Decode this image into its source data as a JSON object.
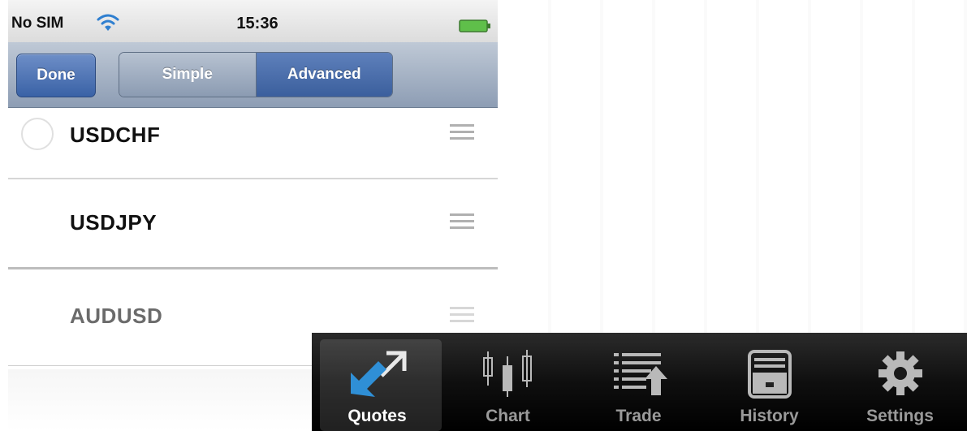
{
  "status_bar": {
    "carrier": "No SIM",
    "time": "15:36"
  },
  "nav_bar": {
    "done_label": "Done",
    "segments": [
      {
        "label": "Simple",
        "selected": false
      },
      {
        "label": "Advanced",
        "selected": true
      }
    ]
  },
  "quotes": [
    {
      "symbol": "USDCHF"
    },
    {
      "symbol": "USDJPY"
    },
    {
      "symbol": "AUDUSD"
    }
  ],
  "tab_bar": {
    "tabs": [
      {
        "label": "Quotes",
        "icon": "quotes-arrows-icon",
        "active": true
      },
      {
        "label": "Chart",
        "icon": "candlestick-chart-icon",
        "active": false
      },
      {
        "label": "Trade",
        "icon": "trade-list-icon",
        "active": false
      },
      {
        "label": "History",
        "icon": "archive-box-icon",
        "active": false
      },
      {
        "label": "Settings",
        "icon": "gear-icon",
        "active": false
      }
    ]
  },
  "colors": {
    "active_segment": "#3b5f9d",
    "done_button": "#3a62a6",
    "tab_bar": "#0f0f0f",
    "quotes_icon": "#2f8fd6"
  }
}
